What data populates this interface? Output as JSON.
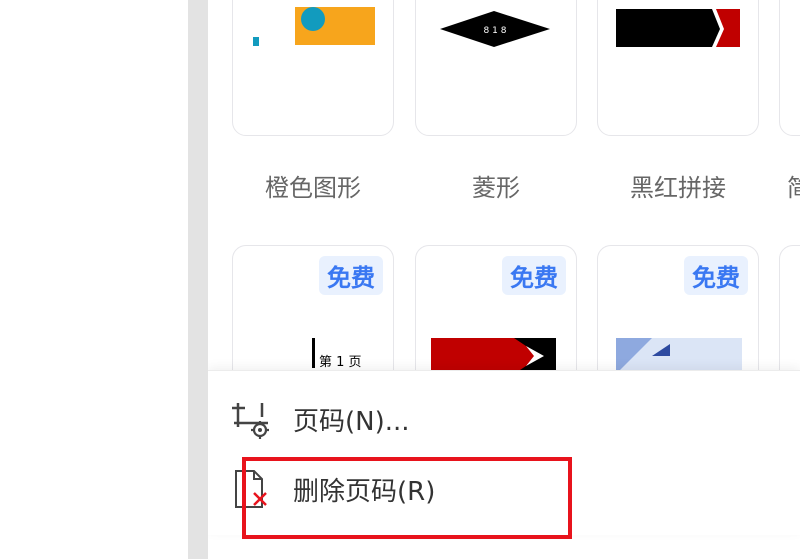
{
  "templates": [
    {
      "label": "橙色图形",
      "badge": ""
    },
    {
      "label": "菱形",
      "badge": "",
      "thumb_text": "8 1 8"
    },
    {
      "label": "黑红拼接",
      "badge": ""
    },
    {
      "label": "简",
      "badge": ""
    },
    {
      "label": "",
      "badge": "免费",
      "thumb_text": "第 1 页"
    },
    {
      "label": "",
      "badge": "免费"
    },
    {
      "label": "",
      "badge": "免费"
    }
  ],
  "menu": {
    "items": [
      {
        "label": "页码(N)...",
        "icon": "page-number-settings-icon"
      },
      {
        "label": "删除页码(R)",
        "icon": "delete-page-number-icon"
      }
    ]
  },
  "colors": {
    "orange": "#f7a51c",
    "teal": "#129bbe",
    "black": "#000000",
    "red": "#c00000",
    "badge_bg": "#e9f1fe",
    "badge_text": "#3a78f2",
    "highlight_red": "#e8131c"
  }
}
